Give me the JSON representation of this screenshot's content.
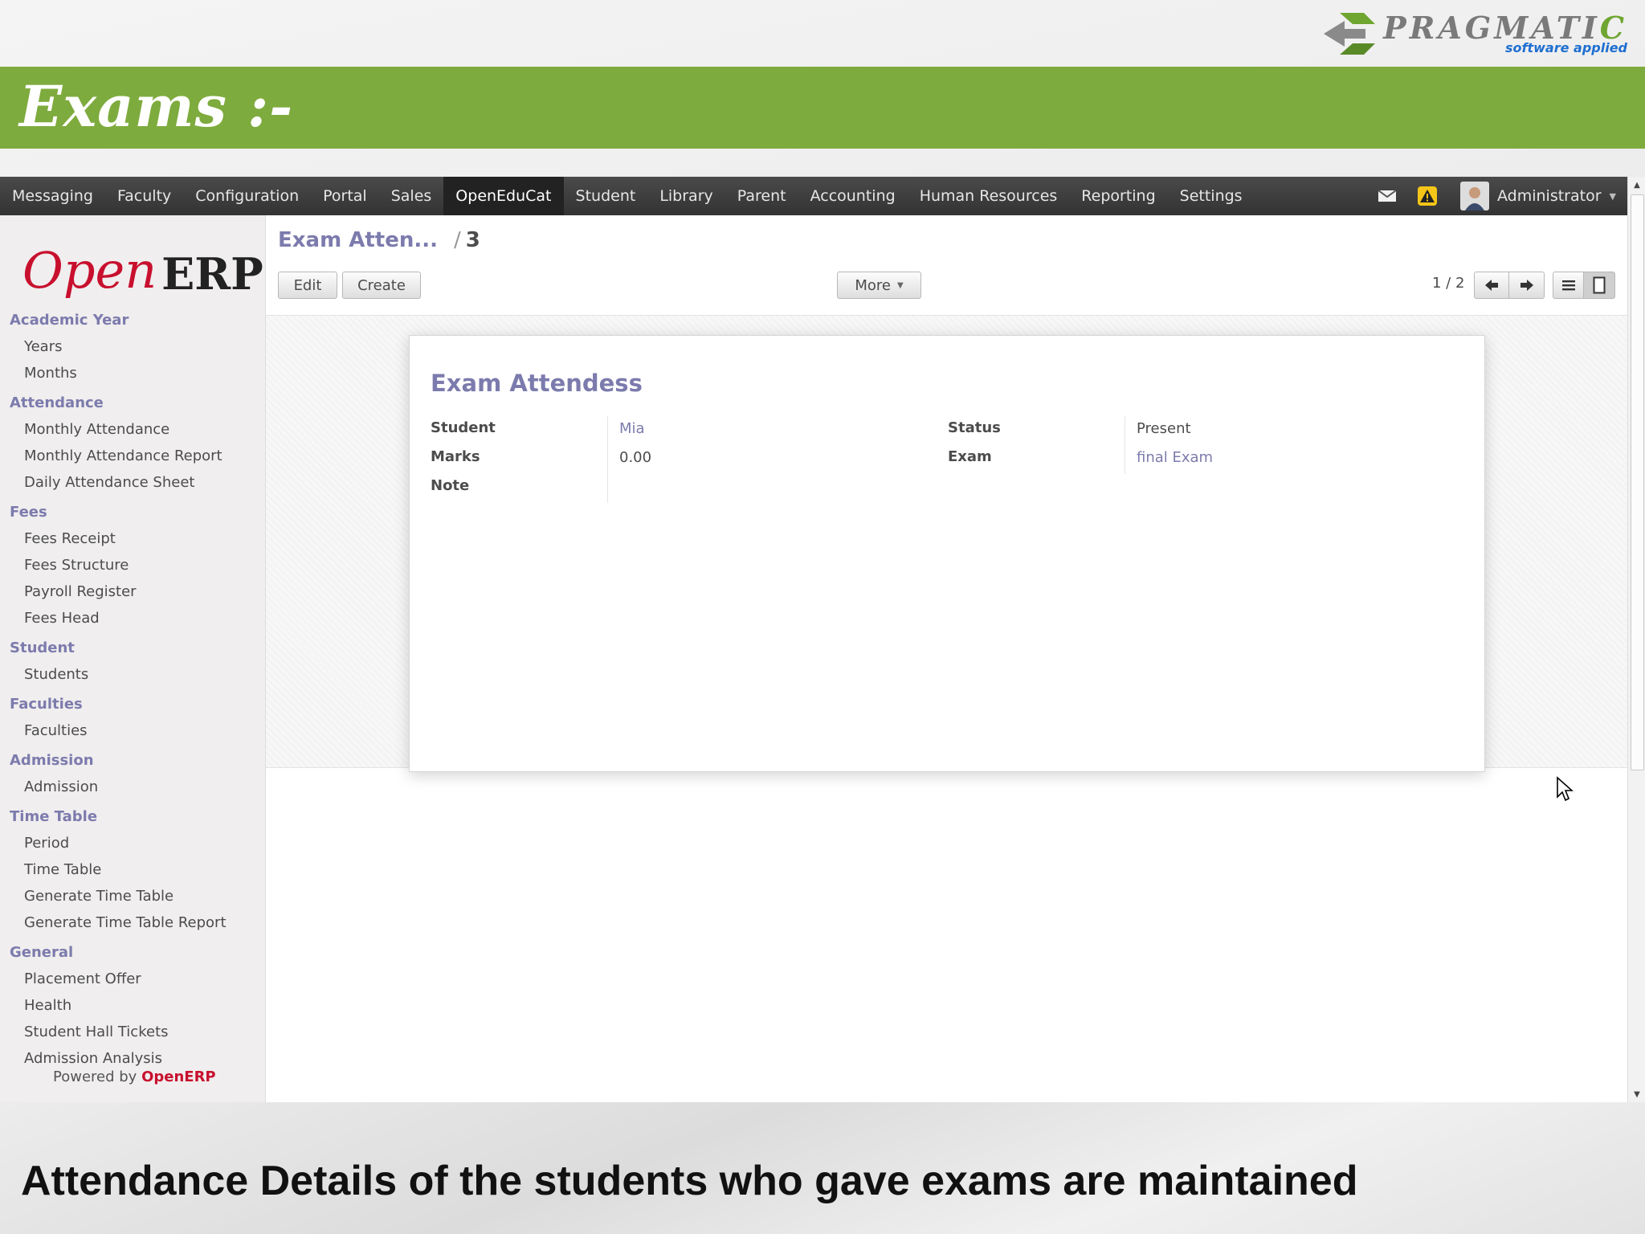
{
  "brand": {
    "word_first": "P",
    "word_main": "RAGMATI",
    "word_last": "C",
    "tagline": "software applied",
    "accent_color": "#7eab3d"
  },
  "slide": {
    "title": "Exams :-",
    "caption": "Attendance Details of the students who gave exams are maintained"
  },
  "topbar": {
    "menus": [
      "Messaging",
      "Faculty",
      "Configuration",
      "Portal",
      "Sales",
      "OpenEduCat",
      "Student",
      "Library",
      "Parent",
      "Accounting",
      "Human Resources",
      "Reporting",
      "Settings"
    ],
    "active_menu": "OpenEduCat",
    "mail_icon": "envelope-icon",
    "alert_icon": "warning-icon",
    "user": "Administrator"
  },
  "sidebar": {
    "logo_open": "Open",
    "logo_erp": "ERP",
    "sections": [
      {
        "title": "Academic Year",
        "items": [
          "Years",
          "Months"
        ]
      },
      {
        "title": "Attendance",
        "items": [
          "Monthly Attendance",
          "Monthly Attendance Report",
          "Daily Attendance Sheet"
        ]
      },
      {
        "title": "Fees",
        "items": [
          "Fees Receipt",
          "Fees Structure",
          "Payroll Register",
          "Fees Head"
        ]
      },
      {
        "title": "Student",
        "items": [
          "Students"
        ]
      },
      {
        "title": "Faculties",
        "items": [
          "Faculties"
        ]
      },
      {
        "title": "Admission",
        "items": [
          "Admission"
        ]
      },
      {
        "title": "Time Table",
        "items": [
          "Period",
          "Time Table",
          "Generate Time Table",
          "Generate Time Table Report"
        ]
      },
      {
        "title": "General",
        "items": [
          "Placement Offer",
          "Health",
          "Student Hall Tickets",
          "Admission Analysis"
        ]
      }
    ],
    "powered_prefix": "Powered by ",
    "powered_brand": "OpenERP"
  },
  "control_panel": {
    "breadcrumb_link": "Exam Atten...",
    "breadcrumb_sep": "/",
    "breadcrumb_current": "3",
    "edit_label": "Edit",
    "create_label": "Create",
    "more_label": "More",
    "pager": "1 / 2"
  },
  "form": {
    "title": "Exam Attendess",
    "student_label": "Student",
    "student_value": "Mia",
    "marks_label": "Marks",
    "marks_value": "0.00",
    "note_label": "Note",
    "status_label": "Status",
    "status_value": "Present",
    "exam_label": "Exam",
    "exam_value": "final Exam"
  },
  "colors": {
    "link": "#7c7bad",
    "topbar": "#3b3b3b",
    "openerp_red": "#c8102e"
  }
}
